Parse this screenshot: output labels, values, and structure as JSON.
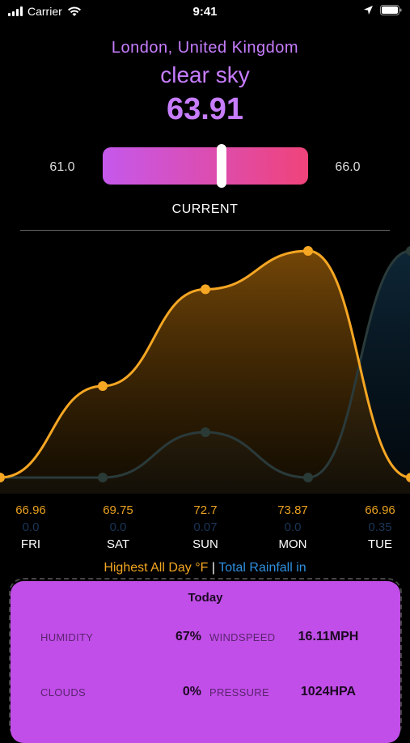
{
  "status_bar": {
    "carrier": "Carrier",
    "time": "9:41"
  },
  "header": {
    "location": "London, United Kingdom",
    "condition": "clear sky",
    "temperature": "63.91"
  },
  "range": {
    "min": "61.0",
    "max": "66.0",
    "current_fraction": 0.58,
    "label": "CURRENT"
  },
  "chart_data": {
    "type": "area",
    "categories": [
      "FRI",
      "SAT",
      "SUN",
      "MON",
      "TUE"
    ],
    "series": [
      {
        "name": "Highest All Day °F",
        "values": [
          66.96,
          69.75,
          72.7,
          73.87,
          66.96
        ]
      },
      {
        "name": "Total Rainfall in",
        "values": [
          0.0,
          0.0,
          0.07,
          0.0,
          0.35
        ]
      }
    ]
  },
  "forecast": [
    {
      "day": "FRI",
      "high": "66.96",
      "rain": "0.0"
    },
    {
      "day": "SAT",
      "high": "69.75",
      "rain": "0.0"
    },
    {
      "day": "SUN",
      "high": "72.7",
      "rain": "0.07"
    },
    {
      "day": "MON",
      "high": "73.87",
      "rain": "0.0"
    },
    {
      "day": "TUE",
      "high": "66.96",
      "rain": "0.35"
    }
  ],
  "legend": {
    "high": "Highest All Day °F",
    "separator": " | ",
    "rain": "Total Rainfall in"
  },
  "today": {
    "title": "Today",
    "humidity_label": "HUMIDITY",
    "humidity": "67%",
    "windspeed_label": "WINDSPEED",
    "windspeed": "16.11MPH",
    "clouds_label": "CLOUDS",
    "clouds": "0%",
    "pressure_label": "PRESSURE",
    "pressure": "1024HPA"
  },
  "colors": {
    "accent": "#c77dff",
    "high_line": "#f5a623",
    "rain_line": "#2f8fdf",
    "card": "#c14ee8"
  }
}
